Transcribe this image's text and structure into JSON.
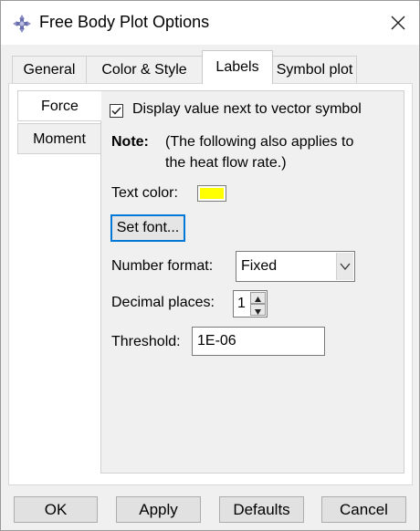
{
  "window": {
    "title": "Free Body Plot Options",
    "app_icon": "crosshair-app-icon",
    "close_icon": "close-icon"
  },
  "tabs": [
    {
      "label": "General",
      "active": false
    },
    {
      "label": "Color & Style",
      "active": false
    },
    {
      "label": "Labels",
      "active": true
    },
    {
      "label": "Symbol plot",
      "active": false
    }
  ],
  "subtabs": [
    {
      "label": "Force",
      "active": true
    },
    {
      "label": "Moment",
      "active": false
    }
  ],
  "options": {
    "display_value_label": "Display value next to vector symbol",
    "display_value_checked": true,
    "note_label": "Note:",
    "note_text_line1": "(The following also applies to",
    "note_text_line2": "the heat flow rate.)",
    "text_color_label": "Text color:",
    "text_color_value": "#ffff00",
    "set_font_label": "Set font...",
    "number_format_label": "Number format:",
    "number_format_value": "Fixed",
    "decimal_places_label": "Decimal places:",
    "decimal_places_value": "1",
    "threshold_label": "Threshold:",
    "threshold_value": "1E-06"
  },
  "footer": {
    "ok_label": "OK",
    "apply_label": "Apply",
    "defaults_label": "Defaults",
    "cancel_label": "Cancel"
  },
  "colors": {
    "focus_border": "#0078d7",
    "panel_bg": "#f0f0f0",
    "tab_active_bg": "#ffffff"
  }
}
